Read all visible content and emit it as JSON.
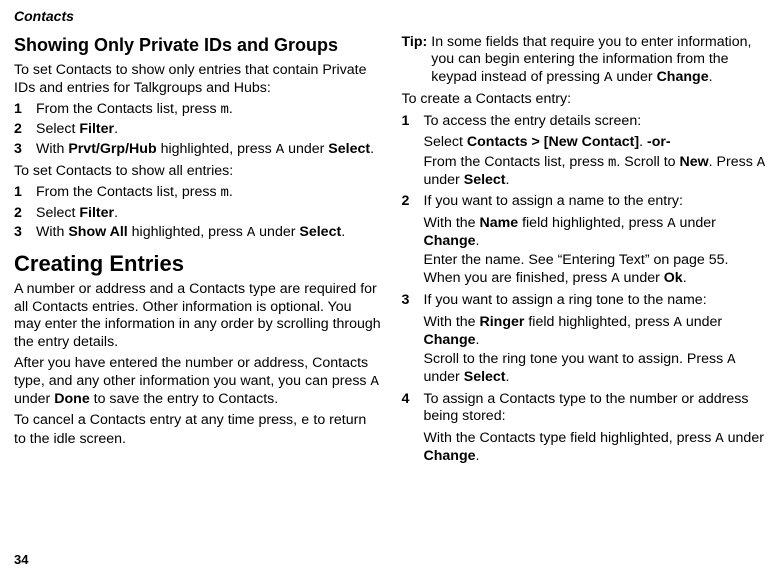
{
  "header": "Contacts",
  "page_number": "34",
  "left": {
    "h_private": "Showing Only Private IDs and Groups",
    "p_intro1": "To set Contacts to show only entries that contain Private IDs and entries for Talkgroups and Hubs:",
    "steps1": {
      "s1a": "From the Contacts list, press ",
      "s1_sym": "m",
      "s1b": ".",
      "s2a": "Select ",
      "s2_bold": "Filter",
      "s2b": ".",
      "s3a": "With ",
      "s3_bold1": "Prvt/Grp/Hub",
      "s3b": " highlighted, press ",
      "s3_sym": "A",
      "s3c": " under ",
      "s3_bold2": "Select",
      "s3d": "."
    },
    "p_intro2": "To set Contacts to show all entries:",
    "steps2": {
      "s1a": "From the Contacts list, press ",
      "s1_sym": "m",
      "s1b": ".",
      "s2a": "Select ",
      "s2_bold": "Filter",
      "s2b": ".",
      "s3a": "With ",
      "s3_bold1": "Show All",
      "s3b": " highlighted, press ",
      "s3_sym": "A",
      "s3c": " under ",
      "s3_bold2": "Select",
      "s3d": "."
    },
    "h_creating": "Creating Entries",
    "p_create1": "A number or address and a Contacts type are required for all Contacts entries. Other information is optional. You may enter the information in any order by scrolling through the entry details.",
    "p_create2a": "After you have entered the number or address, Contacts type, and any other information you want, you can press ",
    "p_create2_sym": "A",
    "p_create2b": " under ",
    "p_create2_bold": "Done",
    "p_create2c": " to save the entry to Contacts.",
    "p_create3a": "To cancel a Contacts entry at any time press, ",
    "p_create3_sym": "e",
    "p_create3b": " to return to the idle screen."
  },
  "right": {
    "tip_label": "Tip:",
    "tip_a": "In some fields that require you to enter information, you can begin entering the information from the keypad instead of pressing ",
    "tip_sym": "A",
    "tip_b": " under ",
    "tip_bold": "Change",
    "tip_c": ".",
    "p_create_intro": "To create a Contacts entry:",
    "r1": {
      "line1": "To access the entry details screen:",
      "sel_a": "Select ",
      "sel_bold": "Contacts > [New Contact]",
      "sel_b": ". ",
      "sel_bold2": "-or-",
      "from_a": "From the Contacts list, press ",
      "from_sym1": "m",
      "from_b": ". Scroll to ",
      "from_bold1": "New",
      "from_c": ". Press ",
      "from_sym2": "A",
      "from_d": " under ",
      "from_bold2": "Select",
      "from_e": "."
    },
    "r2": {
      "line1": "If you want to assign a name to the entry:",
      "name_a": "With the ",
      "name_bold1": "Name",
      "name_b": " field highlighted, press ",
      "name_sym1": "A",
      "name_c": " under ",
      "name_bold2": "Change",
      "name_d": ".",
      "enter_a": "Enter the name. See “Entering Text” on page 55. When you are finished, press ",
      "enter_sym": "A",
      "enter_b": " under ",
      "enter_bold": "Ok",
      "enter_c": "."
    },
    "r3": {
      "line1": "If you want to assign a ring tone to the name:",
      "ring_a": "With the ",
      "ring_bold1": "Ringer",
      "ring_b": " field highlighted, press ",
      "ring_sym1": "A",
      "ring_c": " under ",
      "ring_bold2": "Change",
      "ring_d": ".",
      "scroll_a": "Scroll to the ring tone you want to assign. Press ",
      "scroll_sym": "A",
      "scroll_b": " under ",
      "scroll_bold": "Select",
      "scroll_c": "."
    },
    "r4": {
      "line1": "To assign a Contacts type to the number or address being stored:",
      "ct_a": "With the Contacts type field highlighted, press ",
      "ct_sym": "A",
      "ct_b": " under ",
      "ct_bold": "Change",
      "ct_c": "."
    }
  }
}
